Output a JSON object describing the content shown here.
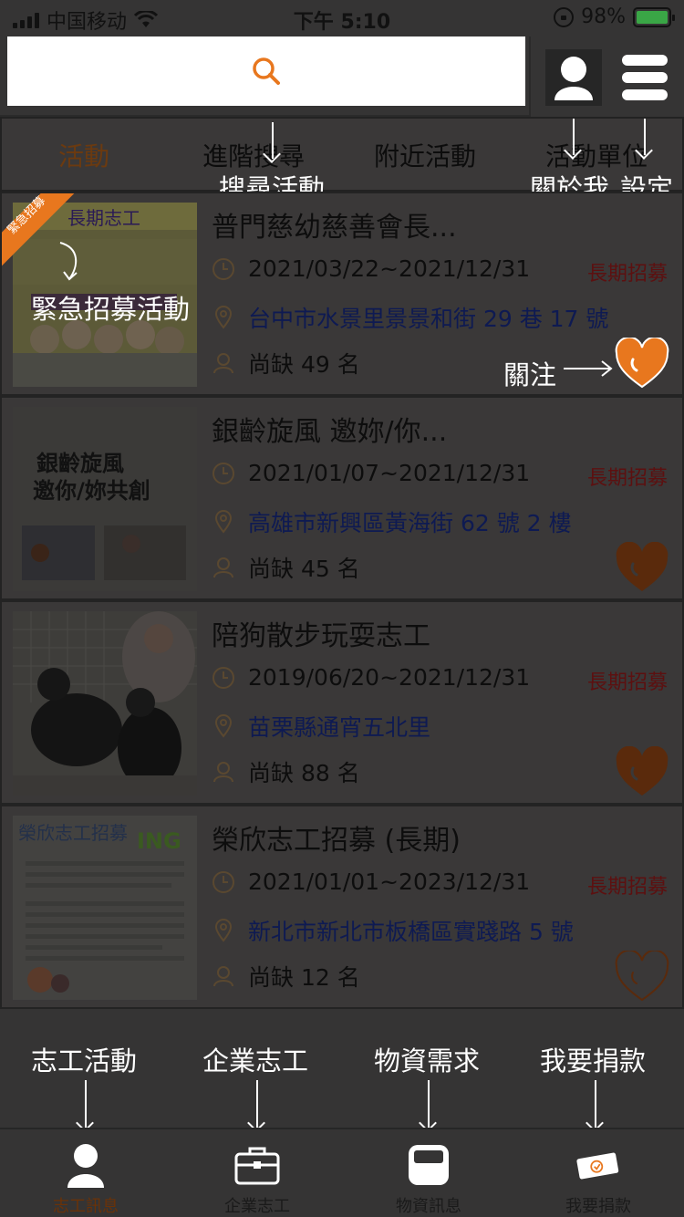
{
  "status_bar": {
    "carrier": "中国移动",
    "time": "下午 5:10",
    "battery": "98%"
  },
  "search": {
    "placeholder": ""
  },
  "tabs": [
    {
      "label": "活動",
      "active": true
    },
    {
      "label": "進階搜尋",
      "active": false
    },
    {
      "label": "附近活動",
      "active": false
    },
    {
      "label": "活動單位",
      "active": false
    }
  ],
  "annotations": {
    "search_activity": "搜尋活動",
    "about_me": "關於我",
    "settings": "設定",
    "urgent": "緊急招募活動",
    "follow": "關注",
    "nav_volunteer": "志工活動",
    "nav_corporate": "企業志工",
    "nav_supplies": "物資需求",
    "nav_donate": "我要捐款"
  },
  "ribbon": "緊急招募",
  "thumb_texts": {
    "t1_banner": "長期志工",
    "t2_line1": "銀齡旋風",
    "t2_line2": "邀你/妳共創",
    "t4_head": "榮欣志工招募",
    "t4_ing": "ING"
  },
  "activities": [
    {
      "title": "普門慈幼慈善會長...",
      "date": "2021/03/22~2021/12/31",
      "status": "長期招募",
      "address": "台中市水景里景景和街 29 巷 17 號",
      "need": "尚缺 49 名",
      "followed": true,
      "urgent": true
    },
    {
      "title": "銀齡旋風 邀妳/你...",
      "date": "2021/01/07~2021/12/31",
      "status": "長期招募",
      "address": "高雄市新興區黃海街 62 號 2 樓",
      "need": "尚缺 45 名",
      "followed": true,
      "urgent": false
    },
    {
      "title": "陪狗散步玩耍志工",
      "date": "2019/06/20~2021/12/31",
      "status": "長期招募",
      "address": "苗栗縣通宵五北里",
      "need": "尚缺 88 名",
      "followed": true,
      "urgent": false
    },
    {
      "title": "榮欣志工招募 (長期)",
      "date": "2021/01/01~2023/12/31",
      "status": "長期招募",
      "address": "新北市新北市板橋區實踐路 5 號",
      "need": "尚缺 12 名",
      "followed": false,
      "urgent": false
    }
  ],
  "bottom_nav": [
    {
      "label": "志工訊息",
      "active": true
    },
    {
      "label": "企業志工",
      "active": false
    },
    {
      "label": "物資訊息",
      "active": false
    },
    {
      "label": "我要捐款",
      "active": false
    }
  ],
  "colors": {
    "accent": "#e8771e",
    "overlay": "#353434",
    "status": "#5c1010",
    "address": "#0e1a52"
  }
}
